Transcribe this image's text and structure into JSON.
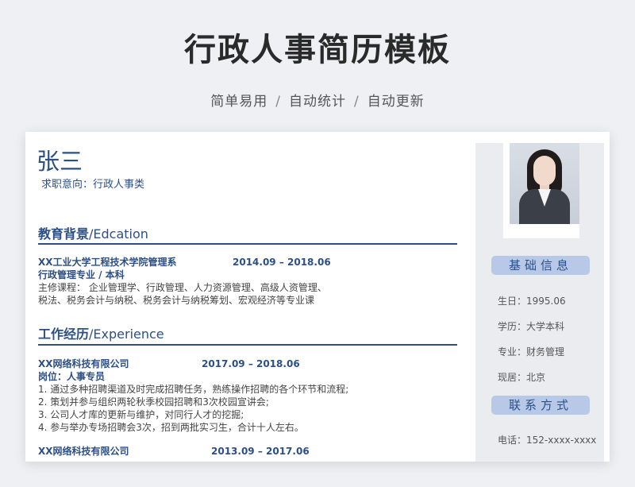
{
  "header": {
    "title": "行政人事简历模板",
    "subtitle_parts": [
      "简单易用",
      "自动统计",
      "自动更新"
    ],
    "separator": "/"
  },
  "resume": {
    "name": "张三",
    "intention": "求职意向：行政人事类",
    "education": {
      "title_cn": "教育背景",
      "title_en": "/Edcation",
      "school": "XX工业大学工程技术学院管理系",
      "date": "2014.09 – 2018.06",
      "major": "行政管理专业 / 本科",
      "courses_line1": "主修课程：  企业管理学、行政管理、人力资源管理、高级人资管理、",
      "courses_line2": "税法、税务会计与纳税、税务会计与纳税筹划、宏观经济等专业课"
    },
    "experience": {
      "title_cn": "工作经历",
      "title_en": "/Experience",
      "jobs": [
        {
          "company": "XX网络科技有限公司",
          "date": "2017.09 – 2018.06",
          "position": "岗位：人事专员",
          "duties": [
            "1. 通过多种招聘渠道及时完成招聘任务，熟练操作招聘的各个环节和流程;",
            "2. 策划并参与组织两轮秋季校园招聘和3次校园宣讲会;",
            "3. 公司人才库的更新与维护，对同行人才的挖掘;",
            "4. 参与举办专场招聘会3次，招到两批实习生，合计十人左右。"
          ]
        },
        {
          "company": "XX网络科技有限公司",
          "date": "2013.09 – 2017.06"
        }
      ]
    },
    "sidebar": {
      "basic_info_title": "基础信息",
      "birth": "生日：1995.06",
      "education": "学历：大学本科",
      "major": "专业：财务管理",
      "residence": "现居：北京",
      "contact_title": "联系方式",
      "phone": "电话：152-xxxx-xxxx"
    }
  },
  "colors": {
    "accent": "#2c4f86",
    "pill": "#b8c9e8",
    "sidebar_bg": "#eaecef"
  }
}
